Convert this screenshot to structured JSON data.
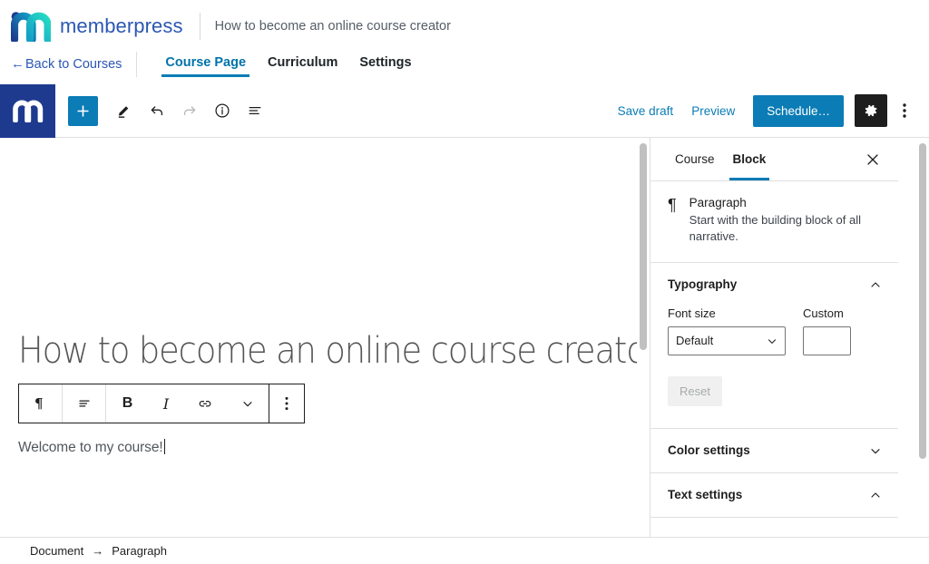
{
  "brand": {
    "name": "memberpress",
    "course_title": "How to become an online course creator",
    "logo_icon": "memberpress-m-logo",
    "editor_logo_icon": "memberpress-m-mark"
  },
  "nav": {
    "back_label": "Back to Courses",
    "back_arrow": "←",
    "tabs": [
      {
        "label": "Course Page",
        "active": true
      },
      {
        "label": "Curriculum",
        "active": false
      },
      {
        "label": "Settings",
        "active": false
      }
    ]
  },
  "toolbar": {
    "add_block_icon": "plus-icon",
    "tools_icon": "pencil-edit-icon",
    "undo_icon": "undo-arrow-icon",
    "redo_icon": "redo-arrow-icon",
    "info_icon": "info-circle-icon",
    "list_view_icon": "list-view-icon",
    "save_draft_label": "Save draft",
    "preview_label": "Preview",
    "schedule_label": "Schedule…",
    "settings_icon": "gear-icon",
    "more_icon": "kebab-menu-icon"
  },
  "block_toolbar": {
    "paragraph_icon": "paragraph-pilcrow-icon",
    "align_icon": "align-text-icon",
    "bold_label": "B",
    "italic_label": "I",
    "link_icon": "link-icon",
    "more_formats_icon": "chevron-down-icon",
    "options_icon": "kebab-menu-icon"
  },
  "editor": {
    "post_title": "How to become an online course creator",
    "paragraph_text": "Welcome to my course!"
  },
  "sidebar": {
    "tabs": [
      {
        "label": "Course",
        "active": false
      },
      {
        "label": "Block",
        "active": true
      }
    ],
    "close_icon": "close-x-icon",
    "block_card": {
      "icon": "paragraph-pilcrow-icon",
      "name": "Paragraph",
      "description": "Start with the building block of all narrative."
    },
    "panels": [
      {
        "title": "Typography",
        "expanded": true,
        "chevron": "chevron-up-icon",
        "font_size_label": "Font size",
        "font_size_value": "Default",
        "font_size_options": [
          "Default"
        ],
        "custom_label": "Custom",
        "custom_value": "",
        "reset_label": "Reset"
      },
      {
        "title": "Color settings",
        "expanded": false,
        "chevron": "chevron-down-icon"
      },
      {
        "title": "Text settings",
        "expanded": true,
        "chevron": "chevron-up-icon"
      }
    ]
  },
  "footer": {
    "breadcrumb": [
      "Document",
      "Paragraph"
    ],
    "separator": "→"
  },
  "colors": {
    "accent_blue": "#0b7cb5",
    "brand_blue": "#2b57b5",
    "logo_block": "#1e3a8f",
    "dark_button": "#1e1e1e"
  }
}
